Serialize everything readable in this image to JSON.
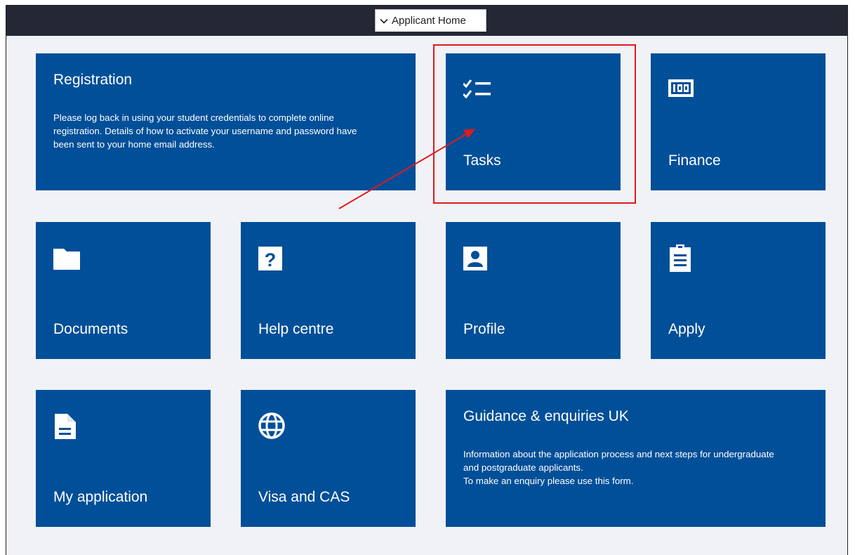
{
  "header": {
    "home_button_label": "Applicant Home",
    "bar_color": "#232834"
  },
  "accent": {
    "tile_color": "#004f98",
    "annotation_color": "#e0191f"
  },
  "tiles": {
    "registration": {
      "title": "Registration",
      "body": [
        "Please log back in using your student credentials to complete online",
        "registration. Details of how to activate your username and password have",
        "been sent to your home email address."
      ]
    },
    "tasks": {
      "label": "Tasks",
      "icon": "checklist-icon"
    },
    "finance": {
      "label": "Finance",
      "icon": "finance-icon"
    },
    "documents": {
      "label": "Documents",
      "icon": "folder-icon"
    },
    "help_centre": {
      "label": "Help centre",
      "icon": "question-icon"
    },
    "profile": {
      "label": "Profile",
      "icon": "person-icon"
    },
    "apply": {
      "label": "Apply",
      "icon": "clipboard-icon"
    },
    "my_application": {
      "label": "My application",
      "icon": "document-icon"
    },
    "visa": {
      "label": "Visa and CAS",
      "icon": "globe-icon"
    },
    "guidance": {
      "title": "Guidance & enquiries UK",
      "body": [
        "Information about the application process and next steps for undergraduate",
        "and postgraduate applicants.",
        "To make an enquiry please use this form."
      ]
    }
  }
}
